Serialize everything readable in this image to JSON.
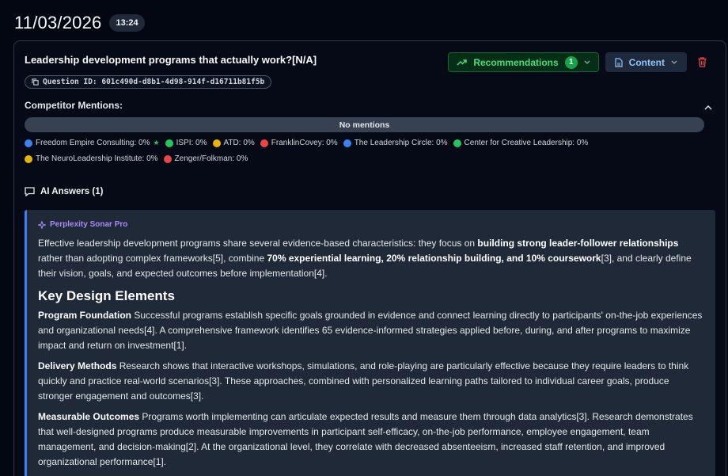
{
  "date": "11/03/2026",
  "time": "13:24",
  "question": {
    "title": "Leadership development programs that actually work?[N/A]",
    "id_label": "Question ID: 601c490d-d8b1-4d98-914f-d16711b81f5b"
  },
  "actions": {
    "recommendations_label": "Recommendations",
    "recommendations_count": "1",
    "content_label": "Content"
  },
  "competitors": {
    "label": "Competitor Mentions:",
    "bar_text": "No mentions",
    "items": [
      {
        "name": "Freedom Empire Consulting: 0%",
        "color": "#3b82f6",
        "star": true
      },
      {
        "name": "ISPI: 0%",
        "color": "#22c55e"
      },
      {
        "name": "ATD: 0%",
        "color": "#eab308"
      },
      {
        "name": "FranklinCovey: 0%",
        "color": "#ef4444"
      },
      {
        "name": "The Leadership Circle: 0%",
        "color": "#3b82f6"
      },
      {
        "name": "Center for Creative Leadership: 0%",
        "color": "#22c55e"
      },
      {
        "name": "The NeuroLeadership Institute: 0%",
        "color": "#eab308"
      },
      {
        "name": "Zenger/Folkman: 0%",
        "color": "#ef4444"
      }
    ]
  },
  "ai_answers": {
    "header": "AI Answers (1)",
    "model": "Perplexity Sonar Pro",
    "intro": {
      "t1": "Effective leadership development programs share several evidence-based characteristics: they focus on ",
      "b1": "building strong leader-follower relationships",
      "t2": " rather than adopting complex frameworks[5], combine ",
      "b2": "70% experiential learning, 20% relationship building, and 10% coursework",
      "t3": "[3], and clearly define their vision, goals, and expected outcomes before implementation[4]."
    },
    "heading": "Key Design Elements",
    "sections": [
      {
        "title": "Program Foundation",
        "text": " Successful programs establish specific goals grounded in evidence and connect learning directly to participants' on-the-job experiences and organizational needs[4]. A comprehensive framework identifies 65 evidence-informed strategies applied before, during, and after programs to maximize impact and return on investment[1]."
      },
      {
        "title": "Delivery Methods",
        "text": " Research shows that interactive workshops, simulations, and role-playing are particularly effective because they require leaders to think quickly and practice real-world scenarios[3]. These approaches, combined with personalized learning paths tailored to individual career goals, produce stronger engagement and outcomes[3]."
      },
      {
        "title": "Measurable Outcomes",
        "text": " Programs worth implementing can articulate expected results and measure them through data analytics[3]. Research demonstrates that well-designed programs produce measurable improvements in participant self-efficacy, on-the-job performance, employee engagement, team management, and decision-making[2]. At the organizational level, they correlate with decreased absenteeism, increased staff retention, and improved organizational performance[1]."
      }
    ]
  }
}
